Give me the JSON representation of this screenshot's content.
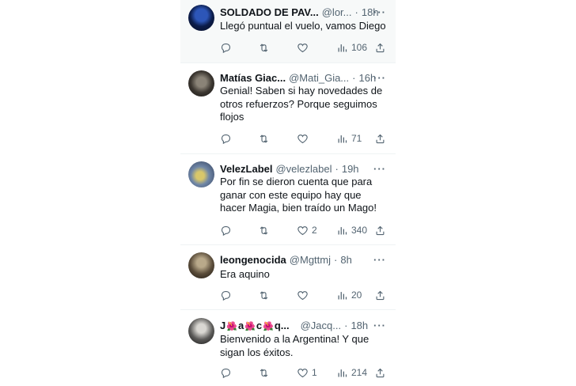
{
  "tweets": [
    {
      "name": "SOLDADO DE PAV...",
      "handle": "@lor...",
      "dot": "·",
      "time": "18h",
      "text": "Llegó puntual el vuelo, vamos Diego",
      "likes": "",
      "views": "106",
      "avatar_icon": "profile-photo-blue"
    },
    {
      "name": "Matías Giac...",
      "handle": "@Mati_Gia...",
      "dot": "·",
      "time": "16h",
      "text": "Genial! Saben si hay novedades de otros refuerzos? Porque seguimos flojos",
      "likes": "",
      "views": "71",
      "avatar_icon": "profile-photo-dark"
    },
    {
      "name": "VelezLabel",
      "handle": "@velezlabel",
      "dot": "·",
      "time": "19h",
      "text": "Por fin se dieron cuenta que para ganar con este equipo hay que hacer Magia, bien traído un Mago!",
      "likes": "2",
      "views": "340",
      "avatar_icon": "profile-photo-stadium"
    },
    {
      "name": "leongenocida",
      "handle": "@Mgttmj",
      "dot": "·",
      "time": "8h",
      "text": "Era aquino",
      "likes": "",
      "views": "20",
      "avatar_icon": "profile-photo-portrait"
    },
    {
      "name_parts": [
        "J",
        "a",
        "c",
        "q..."
      ],
      "handle": "@Jacq...",
      "dot": "·",
      "time": "18h",
      "text": "Bienvenido a la Argentina! Y que sigan los éxitos.",
      "likes": "1",
      "views": "214",
      "avatar_icon": "profile-photo-bw"
    }
  ],
  "more_glyph": "···",
  "flower_glyph": "🌺",
  "colors": {
    "secondary_text": "#536471",
    "primary_text": "#0f1419",
    "highlight_bg": "#f7f9f9",
    "divider": "#eff3f4"
  }
}
